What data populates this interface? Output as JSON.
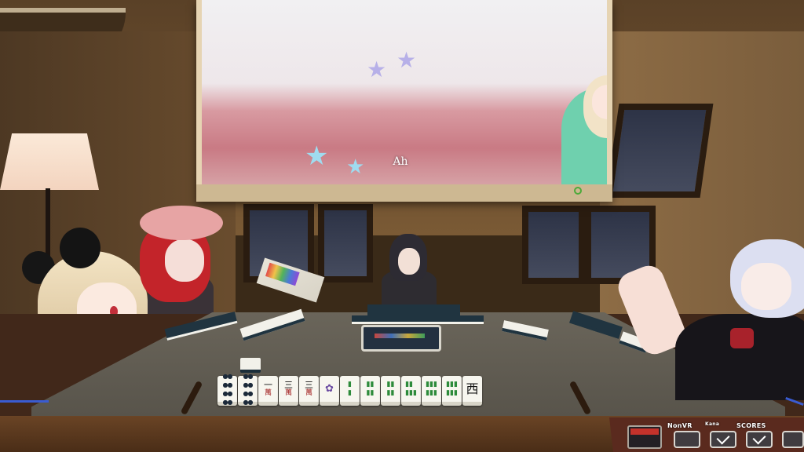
{
  "screen": {
    "subtitle": "Ah"
  },
  "hand_tiles": [
    {
      "type": "pin",
      "glyph": "●●\n●●\n●●\n●●"
    },
    {
      "type": "pin",
      "glyph": "●●\n●●\n●●\n●●"
    },
    {
      "type": "man",
      "glyph": "一",
      "sub": "萬"
    },
    {
      "type": "man",
      "glyph": "三",
      "sub": "萬"
    },
    {
      "type": "man",
      "glyph": "三",
      "sub": "萬"
    },
    {
      "type": "flower",
      "glyph": "✿"
    },
    {
      "type": "sou",
      "glyph": "▮\n▮"
    },
    {
      "type": "sou",
      "glyph": "▮▮\n▮▮"
    },
    {
      "type": "sou",
      "glyph": "▮▮\n▮▮"
    },
    {
      "type": "sou",
      "glyph": "▮▮\n▮▮▮"
    },
    {
      "type": "sou",
      "glyph": "▮▮▮\n▮▮▮"
    },
    {
      "type": "sou",
      "glyph": "▮▮▮\n▮▮▮"
    },
    {
      "type": "honor",
      "glyph": "西"
    }
  ],
  "hud": {
    "nvr_label": "NonVR",
    "small_label": "Kana",
    "scores_label": "SCORES"
  },
  "colors": {
    "hud_bg": "#5a2a1e",
    "table_felt": "#5f5a50",
    "screen_sky": "#f1f0f2"
  }
}
